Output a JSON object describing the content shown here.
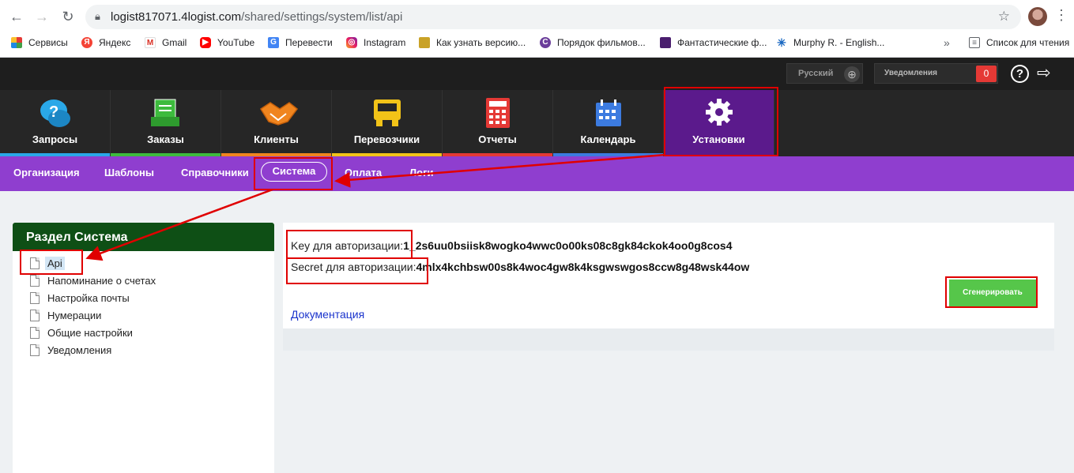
{
  "browser": {
    "url_host": "logist817071.4logist.com",
    "url_path": "/shared/settings/system/list/api",
    "bookmarks": [
      {
        "label": "Сервисы",
        "icon": "apps-grid-icon"
      },
      {
        "label": "Яндекс",
        "icon": "yandex-icon"
      },
      {
        "label": "Gmail",
        "icon": "gmail-icon"
      },
      {
        "label": "YouTube",
        "icon": "youtube-icon"
      },
      {
        "label": "Перевести",
        "icon": "translate-icon"
      },
      {
        "label": "Instagram",
        "icon": "instagram-icon"
      },
      {
        "label": "Как узнать версию...",
        "icon": "page-icon"
      },
      {
        "label": "Порядок фильмов...",
        "icon": "c-letter-icon"
      },
      {
        "label": "Фантастические ф...",
        "icon": "film-icon"
      },
      {
        "label": "Murphy R. - English...",
        "icon": "star-burst-icon"
      }
    ],
    "more": "»",
    "reading_list": "Список для чтения"
  },
  "topbar": {
    "language": "Русский",
    "notifications_label": "Уведомления",
    "notifications_count": "0"
  },
  "modules": [
    {
      "label": "Запросы",
      "icon": "chat-question-icon",
      "bar_color": "#2aa8e8"
    },
    {
      "label": "Заказы",
      "icon": "tray-document-icon",
      "bar_color": "#3dbb3d"
    },
    {
      "label": "Клиенты",
      "icon": "handshake-icon",
      "bar_color": "#f0851f"
    },
    {
      "label": "Перевозчики",
      "icon": "truck-icon",
      "bar_color": "#f2c318"
    },
    {
      "label": "Отчеты",
      "icon": "calculator-icon",
      "bar_color": "#e53935"
    },
    {
      "label": "Календарь",
      "icon": "calendar-icon",
      "bar_color": "#3c7be0"
    },
    {
      "label": "Установки",
      "icon": "gear-icon",
      "bar_color": "#5b1a8c"
    }
  ],
  "subnav": [
    "Организация",
    "Шаблоны",
    "Справочники",
    "Система",
    "Оплата",
    "Логи"
  ],
  "left": {
    "title": "Раздел Система",
    "items": [
      "Api",
      "Напоминание о счетах",
      "Настройка почты",
      "Нумерации",
      "Общие настройки",
      "Уведомления"
    ]
  },
  "api": {
    "key_label": "Key для авторизации:",
    "key_value": "1_2s6uu0bsiisk8wogko4wwc0o00ks08c8gk84ckok4oo0g8cos4",
    "secret_label": "Secret для авторизации:",
    "secret_value": "4mlx4kchbsw00s8k4woc4gw8k4ksgwswgos8ccw8g48wsk44ow",
    "generate_button": "Сгенерировать",
    "doc_link": "Документация"
  },
  "colors": {
    "annotation": "#e00000",
    "subnav_bg": "#8f3ecf",
    "active_module": "#5b1a8c",
    "panel_header": "#0e4f15",
    "generate_btn": "#56c64a"
  }
}
